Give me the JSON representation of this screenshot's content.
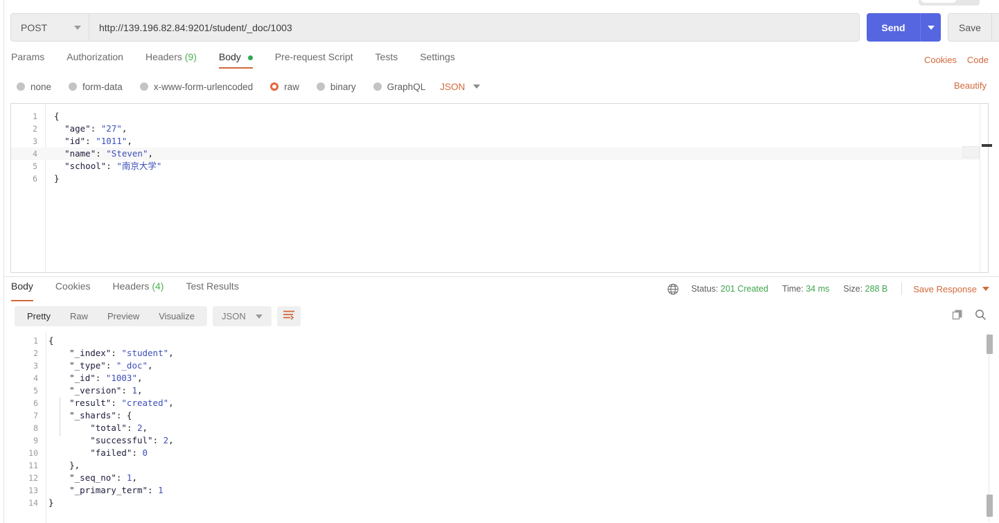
{
  "request": {
    "method": "POST",
    "url": "http://139.196.82.84:9201/student/_doc/1003",
    "send_label": "Send",
    "save_label": "Save",
    "tabs": [
      {
        "label": "Params",
        "count": "",
        "active": false,
        "dot": false
      },
      {
        "label": "Authorization",
        "count": "",
        "active": false,
        "dot": false
      },
      {
        "label": "Headers",
        "count": "(9)",
        "active": false,
        "dot": false
      },
      {
        "label": "Body",
        "count": "",
        "active": true,
        "dot": true
      },
      {
        "label": "Pre-request Script",
        "count": "",
        "active": false,
        "dot": false
      },
      {
        "label": "Tests",
        "count": "",
        "active": false,
        "dot": false
      },
      {
        "label": "Settings",
        "count": "",
        "active": false,
        "dot": false
      }
    ],
    "links": {
      "cookies": "Cookies",
      "code": "Code",
      "beautify": "Beautify"
    },
    "body_types": [
      {
        "label": "none",
        "checked": false
      },
      {
        "label": "form-data",
        "checked": false
      },
      {
        "label": "x-www-form-urlencoded",
        "checked": false
      },
      {
        "label": "raw",
        "checked": true
      },
      {
        "label": "binary",
        "checked": false
      },
      {
        "label": "GraphQL",
        "checked": false
      }
    ],
    "raw_format": "JSON",
    "body_lines": [
      {
        "n": "1",
        "text": "{",
        "hl": false
      },
      {
        "n": "2",
        "text": "  \"age\": \"27\",",
        "hl": false
      },
      {
        "n": "3",
        "text": "  \"id\": \"1011\",",
        "hl": false
      },
      {
        "n": "4",
        "text": "  \"name\": \"Steven\",",
        "hl": true
      },
      {
        "n": "5",
        "text": "  \"school\": \"南京大学\"",
        "hl": false
      },
      {
        "n": "6",
        "text": "}",
        "hl": false
      }
    ]
  },
  "response": {
    "tabs": [
      {
        "label": "Body",
        "count": "",
        "active": true
      },
      {
        "label": "Cookies",
        "count": "",
        "active": false
      },
      {
        "label": "Headers",
        "count": "(4)",
        "active": false
      },
      {
        "label": "Test Results",
        "count": "",
        "active": false
      }
    ],
    "status_label": "Status:",
    "status_value": "201 Created",
    "time_label": "Time:",
    "time_value": "34 ms",
    "size_label": "Size:",
    "size_value": "288 B",
    "save_response": "Save Response",
    "view_modes": [
      {
        "label": "Pretty",
        "active": true
      },
      {
        "label": "Raw",
        "active": false
      },
      {
        "label": "Preview",
        "active": false
      },
      {
        "label": "Visualize",
        "active": false
      }
    ],
    "format": "JSON",
    "body_lines": [
      {
        "n": "1",
        "text": "{"
      },
      {
        "n": "2",
        "text": "    \"_index\": \"student\","
      },
      {
        "n": "3",
        "text": "    \"_type\": \"_doc\","
      },
      {
        "n": "4",
        "text": "    \"_id\": \"1003\","
      },
      {
        "n": "5",
        "text": "    \"_version\": 1,"
      },
      {
        "n": "6",
        "text": "    \"result\": \"created\","
      },
      {
        "n": "7",
        "text": "    \"_shards\": {"
      },
      {
        "n": "8",
        "text": "        \"total\": 2,"
      },
      {
        "n": "9",
        "text": "        \"successful\": 2,"
      },
      {
        "n": "10",
        "text": "        \"failed\": 0"
      },
      {
        "n": "11",
        "text": "    },"
      },
      {
        "n": "12",
        "text": "    \"_seq_no\": 1,"
      },
      {
        "n": "13",
        "text": "    \"_primary_term\": 1"
      },
      {
        "n": "14",
        "text": "}"
      }
    ]
  },
  "colors": {
    "accent_orange": "#d2683b",
    "send_blue": "#5566e0",
    "status_green": "#3fa34d",
    "raw_radio": "#e8653c"
  }
}
